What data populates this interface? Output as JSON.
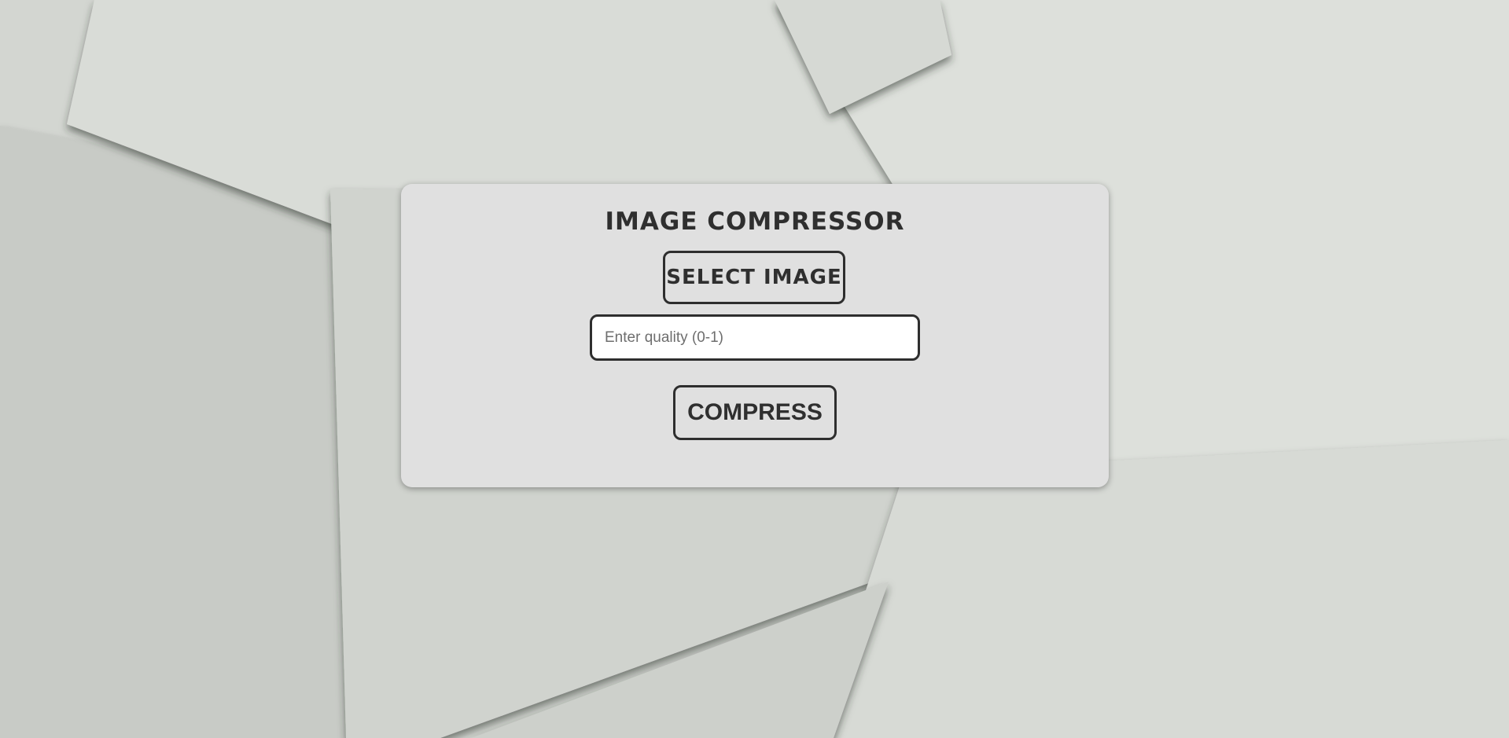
{
  "app": {
    "title": "IMAGE COMPRESSOR"
  },
  "controls": {
    "select_label": "SELECT IMAGE",
    "quality_placeholder": "Enter quality (0-1)",
    "quality_value": "",
    "compress_label": "COMPRESS"
  },
  "colors": {
    "card_background": "#e0e0e0",
    "text": "#2f2f2f",
    "border": "#2e2e2e",
    "page_background": "#d8dbd6"
  }
}
